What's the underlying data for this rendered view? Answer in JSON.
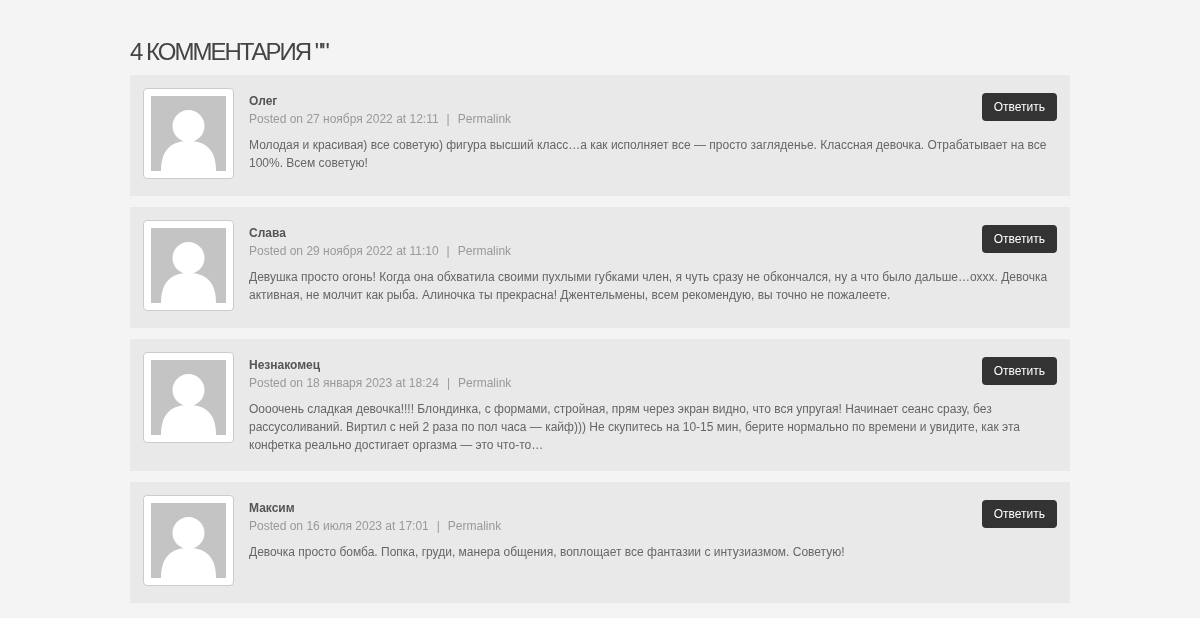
{
  "heading": "4 КОММЕНТАРИЯ \"\"",
  "comments": [
    {
      "author": "Олег",
      "posted": "Posted on 27 ноября 2022 at 12:11",
      "separator": "|",
      "permalink": "Permalink",
      "reply": "Ответить",
      "text": "Молодая и красивая) все советую) фигура высший класс…а как исполняет все — просто загляденье. Классная девочка. Отрабатывает на все 100%. Всем советую!"
    },
    {
      "author": "Слава",
      "posted": "Posted on 29 ноября 2022 at 11:10",
      "separator": "|",
      "permalink": "Permalink",
      "reply": "Ответить",
      "text": "Девушка просто огонь! Когда она обхватила своими пухлыми губками член, я чуть сразу не обкончался, ну а что было дальше…оххх. Девочка активная, не молчит как рыба. Алиночка ты прекрасна! Джентельмены, всем рекомендую, вы точно не пожалеете."
    },
    {
      "author": "Незнакомец",
      "posted": "Posted on 18 января 2023 at 18:24",
      "separator": "|",
      "permalink": "Permalink",
      "reply": "Ответить",
      "text": "Оооочень сладкая девочка!!!! Блондинка, с формами, стройная, прям через экран видно, что вся упругая! Начинает сеанс сразу, без рассусоливаний. Виртил с ней 2 раза по пол часа — кайф))) Не скупитесь на 10-15 мин, берите нормально по времени и увидите, как эта конфетка реально достигает оргазма — это что-то…"
    },
    {
      "author": "Максим",
      "posted": "Posted on 16 июля 2023 at 17:01",
      "separator": "|",
      "permalink": "Permalink",
      "reply": "Ответить",
      "text": "Девочка просто бомба. Попка, груди, манера общения, воплощает все фантазии с интузиазмом. Советую!"
    }
  ]
}
